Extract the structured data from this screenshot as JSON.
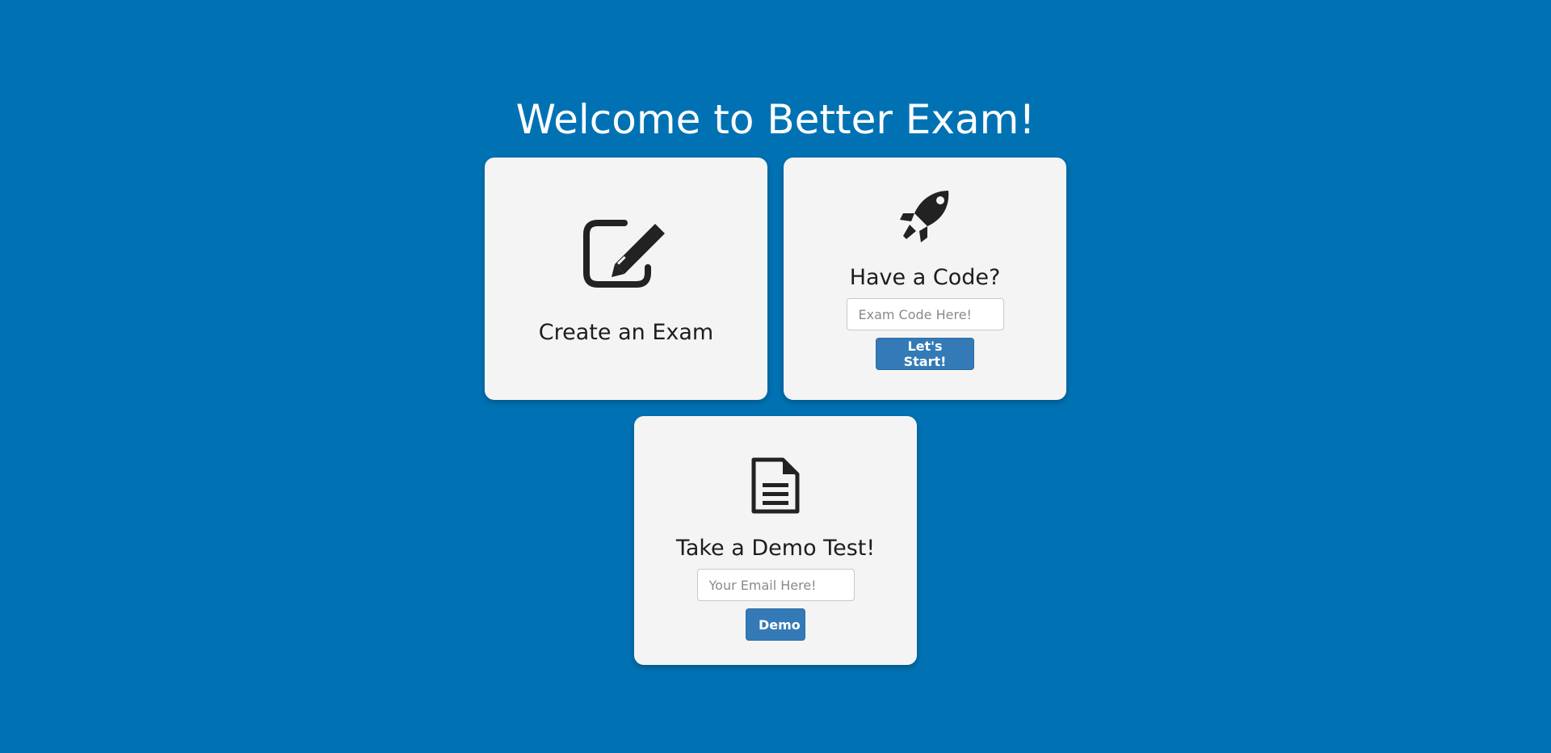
{
  "header": {
    "title": "Welcome to Better Exam!"
  },
  "create_card": {
    "title": "Create an Exam",
    "icon": "edit-icon"
  },
  "code_card": {
    "title": "Have a Code?",
    "icon": "rocket-icon",
    "input_placeholder": "Exam Code Here!",
    "input_value": "",
    "button_label": "Let's Start!"
  },
  "demo_card": {
    "title": "Take a Demo Test!",
    "icon": "document-icon",
    "input_placeholder": "Your Email Here!",
    "input_value": "",
    "button_label": "Demo"
  },
  "colors": {
    "background": "#0072b4",
    "card": "#f4f4f4",
    "button": "#337ab7",
    "icon": "#222222"
  }
}
